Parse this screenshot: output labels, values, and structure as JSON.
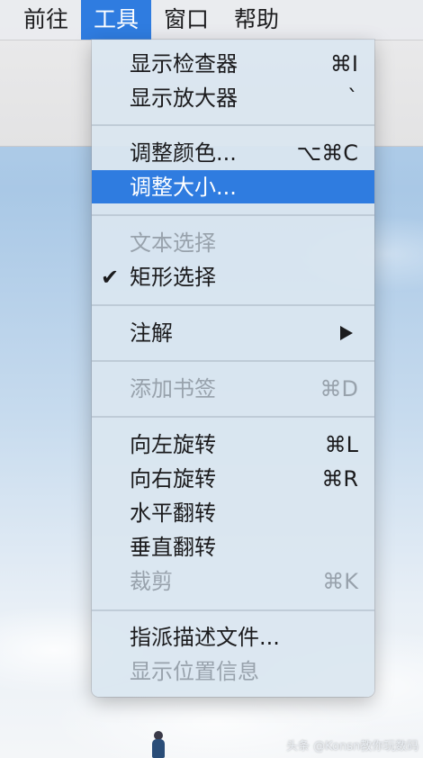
{
  "menubar": {
    "items": [
      {
        "label": "前往"
      },
      {
        "label": "工具",
        "active": true
      },
      {
        "label": "窗口"
      },
      {
        "label": "帮助"
      }
    ]
  },
  "menu": {
    "show_inspector": {
      "label": "显示检查器",
      "shortcut": "⌘I"
    },
    "show_magnifier": {
      "label": "显示放大器",
      "shortcut": "`"
    },
    "adjust_color": {
      "label": "调整颜色...",
      "shortcut": "⌥⌘C"
    },
    "adjust_size": {
      "label": "调整大小..."
    },
    "text_selection": {
      "label": "文本选择"
    },
    "rect_selection": {
      "label": "矩形选择",
      "check": "✔"
    },
    "annotate": {
      "label": "注解"
    },
    "add_bookmark": {
      "label": "添加书签",
      "shortcut": "⌘D"
    },
    "rotate_left": {
      "label": "向左旋转",
      "shortcut": "⌘L"
    },
    "rotate_right": {
      "label": "向右旋转",
      "shortcut": "⌘R"
    },
    "flip_horizontal": {
      "label": "水平翻转"
    },
    "flip_vertical": {
      "label": "垂直翻转"
    },
    "crop": {
      "label": "裁剪",
      "shortcut": "⌘K"
    },
    "assign_profile": {
      "label": "指派描述文件..."
    },
    "show_location": {
      "label": "显示位置信息"
    }
  },
  "watermark": "头条 @Konsn教你玩数码",
  "colors": {
    "accent": "#2f7ce0",
    "disabled": "#98a2ac",
    "menu_bg": "#dae6f0"
  }
}
